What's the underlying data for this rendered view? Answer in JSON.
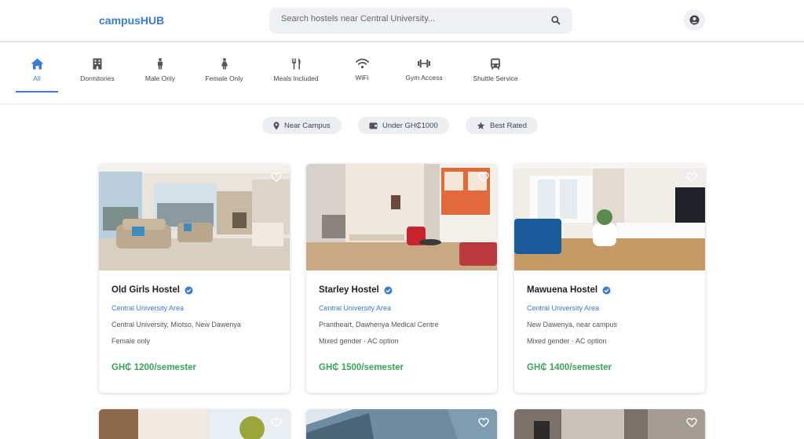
{
  "header": {
    "logo": "campusHUB",
    "search_placeholder": "Search hostels near Central University..."
  },
  "categories": [
    {
      "label": "All",
      "icon": "home-icon",
      "active": true
    },
    {
      "label": "Dormitories",
      "icon": "building-icon"
    },
    {
      "label": "Male Only",
      "icon": "male-icon"
    },
    {
      "label": "Female Only",
      "icon": "female-icon"
    },
    {
      "label": "Meals Included",
      "icon": "utensils-icon"
    },
    {
      "label": "WiFi",
      "icon": "wifi-icon"
    },
    {
      "label": "Gym Access",
      "icon": "dumbbell-icon"
    },
    {
      "label": "Shuttle Service",
      "icon": "bus-icon"
    }
  ],
  "filters": [
    {
      "label": "Near Campus",
      "icon": "location-pin-icon"
    },
    {
      "label": "Under GH₵1000",
      "icon": "wallet-icon"
    },
    {
      "label": "Best Rated",
      "icon": "star-icon"
    }
  ],
  "colors": {
    "accent": "#3a7bd5",
    "price": "#3aa65a"
  },
  "listings": [
    {
      "name": "Old Girls Hostel",
      "area": "Central University Area",
      "address": "Central University, Miotso, New Dawenya",
      "details": "Female only",
      "price": "GH₵ 1200/semester"
    },
    {
      "name": "Starley Hostel",
      "area": "Central University Area",
      "address": "Prantheart, Dawhenya Medical Centre",
      "details": "Mixed gender · AC option",
      "price": "GH₵ 1500/semester"
    },
    {
      "name": "Mawuena Hostel",
      "area": "Central University Area",
      "address": "New Dawenya, near campus",
      "details": "Mixed gender · AC option",
      "price": "GH₵ 1400/semester"
    }
  ]
}
